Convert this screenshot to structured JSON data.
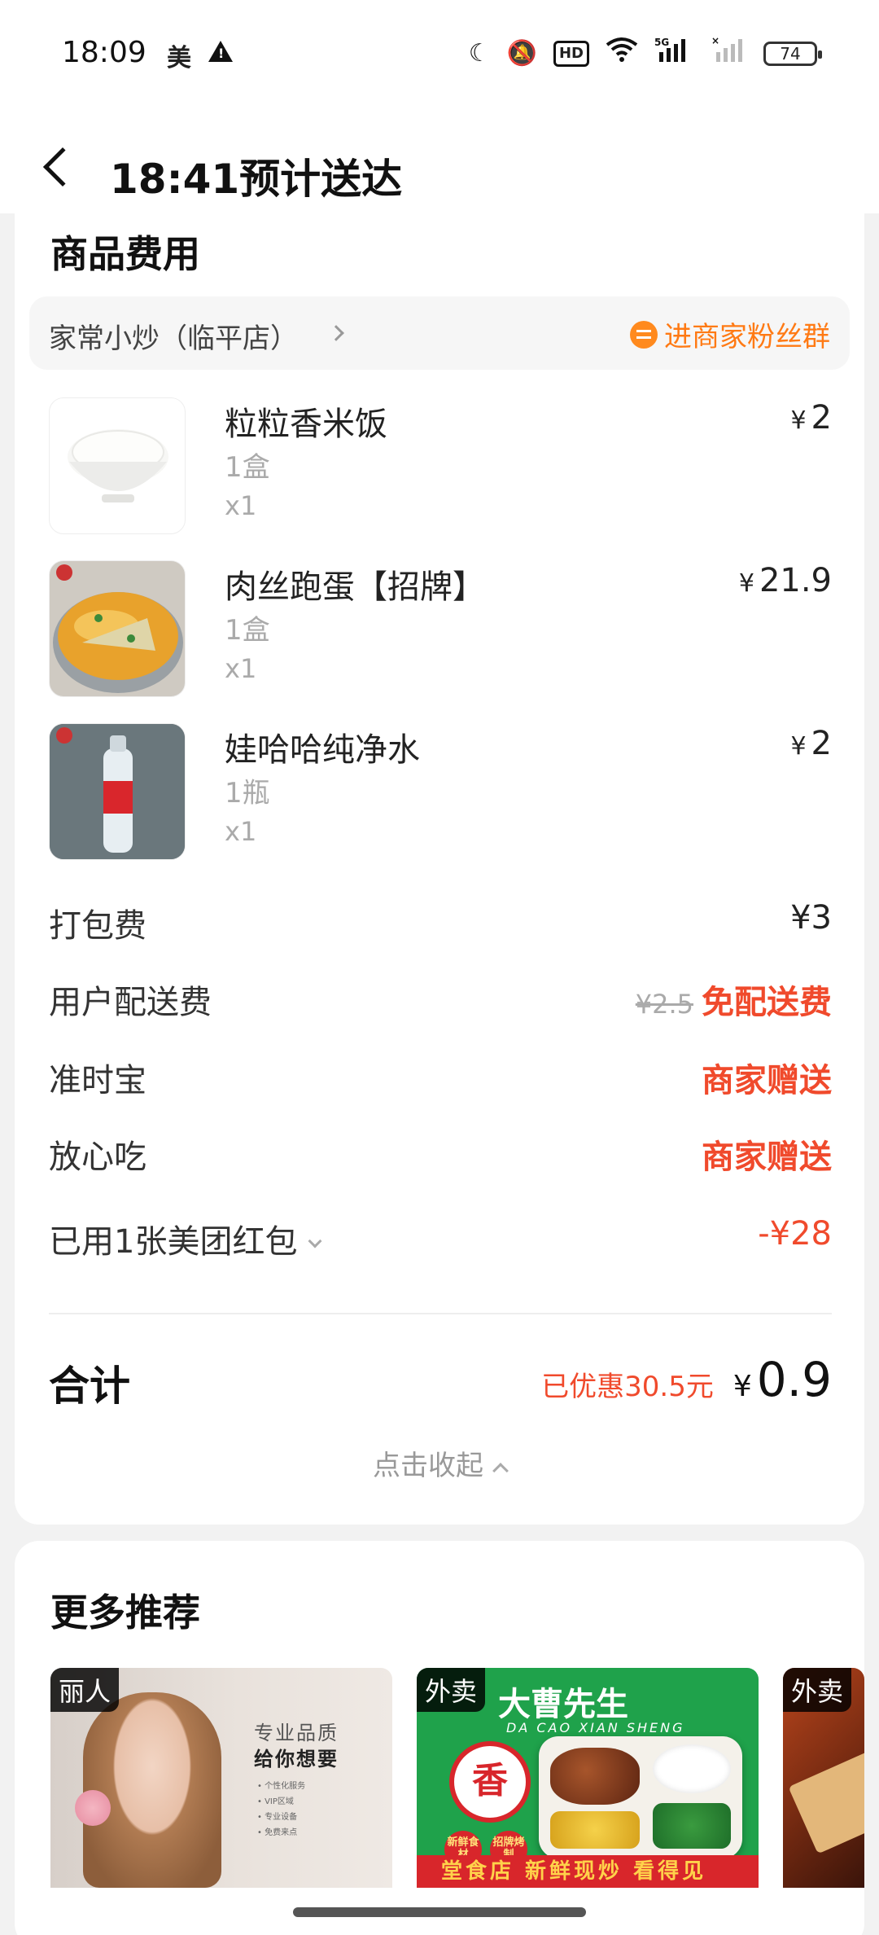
{
  "status_bar": {
    "time": "18:09",
    "app_mark": "美",
    "network_label": "5G",
    "hd_label": "HD",
    "battery": "74"
  },
  "header": {
    "title": "18:41预计送达"
  },
  "fees_section": {
    "title": "商品费用",
    "shop_name": "家常小炒（临平店）",
    "fan_group_label": "进商家粉丝群",
    "items": [
      {
        "name": "粒粒香米饭",
        "spec": "1盒",
        "qty": "x1",
        "currency": "¥",
        "price": "2"
      },
      {
        "name": "肉丝跑蛋【招牌】",
        "spec": "1盒",
        "qty": "x1",
        "currency": "¥",
        "price": "21.9"
      },
      {
        "name": "娃哈哈纯净水",
        "spec": "1瓶",
        "qty": "x1",
        "currency": "¥",
        "price": "2"
      }
    ],
    "packing_fee": {
      "label": "打包费",
      "value": "¥3"
    },
    "delivery_fee": {
      "label": "用户配送费",
      "original": "¥2.5",
      "value": "免配送费"
    },
    "on_time": {
      "label": "准时宝",
      "value": "商家赠送"
    },
    "safe_eat": {
      "label": "放心吃",
      "value": "商家赠送"
    },
    "coupon": {
      "label": "已用1张美团红包",
      "value": "-¥28"
    },
    "total": {
      "label": "合计",
      "saved": "已优惠30.5元",
      "currency": "¥",
      "value": "0.9"
    },
    "collapse_label": "点击收起"
  },
  "recommend": {
    "title": "更多推荐",
    "cards": [
      {
        "tag": "丽人",
        "ad_line1": "专业品质",
        "ad_line2": "给你想要",
        "bullets": [
          "个性化服务",
          "VIP区域",
          "专业设备",
          "免费来点"
        ]
      },
      {
        "tag": "外卖",
        "brand": "大曹先生",
        "brand_en": "DA CAO XIAN SHENG",
        "seal": "香",
        "badge1": "新鲜食材",
        "badge2": "招牌烤制",
        "footer": "堂食店 新鲜现炒 看得见"
      },
      {
        "tag": "外卖"
      }
    ]
  },
  "colors": {
    "accent_red": "#f04a2c",
    "accent_orange": "#ff7a14",
    "green_brand": "#1fa24b"
  }
}
